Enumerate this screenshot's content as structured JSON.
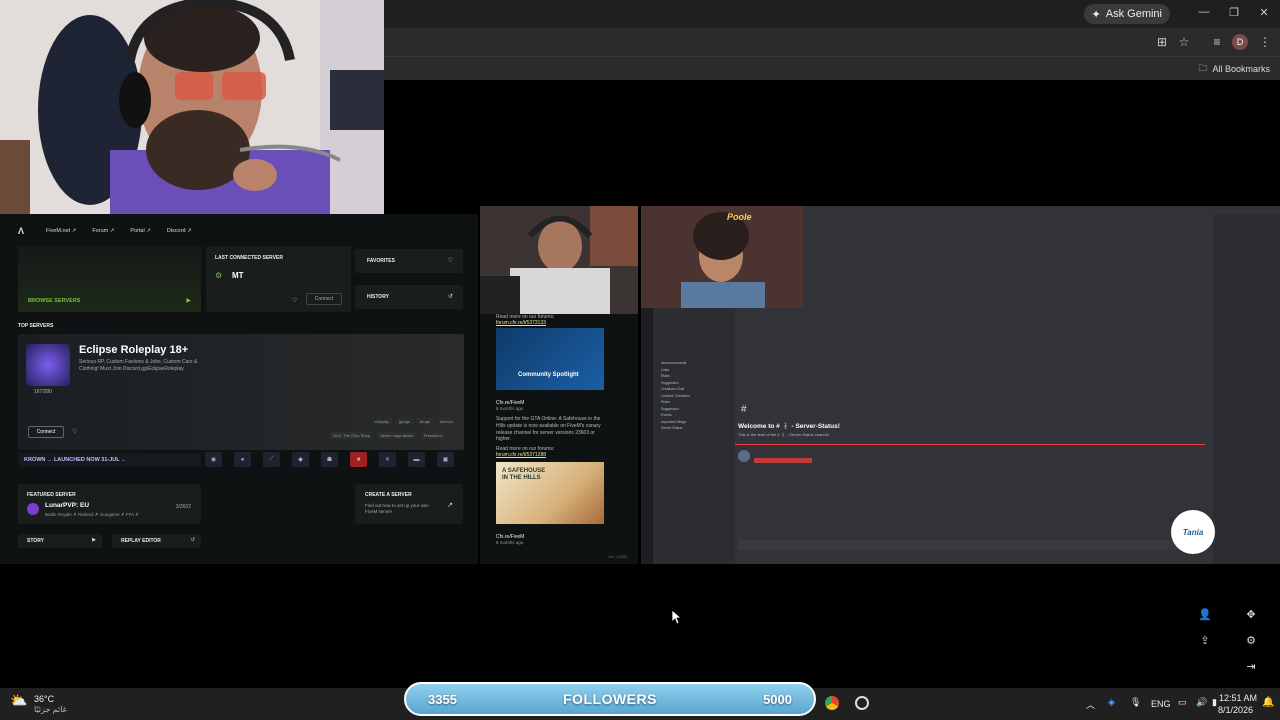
{
  "browser": {
    "ask_gemini": "Ask Gemini",
    "profile_initial": "D",
    "bookmarks_label": "All Bookmarks"
  },
  "fivem": {
    "nav": [
      "FiveM.net ↗",
      "Forum ↗",
      "Portal ↗",
      "Discord ↗"
    ],
    "browse_servers": "BROWSE SERVERS",
    "last_connected_label": "LAST CONNECTED SERVER",
    "last_server_name": "MT",
    "connect_small": "Connect",
    "favorites": "FAVORITES",
    "history": "HISTORY",
    "top_servers": "TOP SERVERS",
    "eclipse_title": "Eclipse Roleplay 18+",
    "eclipse_desc": "Serious RP, Custom Factions & Jobs, Custom Cars & Clothing! Must Join Discord.gg/EclipseRoleplay",
    "eclipse_players": "167/200",
    "eclipse_connect": "Connect",
    "tags": [
      "roleplay",
      "gangs",
      "drugs",
      "serious"
    ],
    "badges": [
      "SLO: The Ohio Shop",
      "Seven rings sticker",
      "Freemium"
    ],
    "krown": "KROWN → LAUNCHED NOW 31-JUL ←",
    "featured_label": "FEATURED SERVER",
    "featured_name": "LunarPVP: EU",
    "featured_desc": "Battle Royale ✗ Ranked ✗ Gungame ✗ FFA ✗",
    "featured_players": "3/2602",
    "create_server": "CREATE A SERVER",
    "create_desc": "Find out how to set up your own FiveM server!",
    "story": "STORY",
    "replay_editor": "REPLAY EDITOR",
    "version": "Ver. 13206"
  },
  "news": {
    "read_more_1": "Read more on our forums:",
    "link_1": "forum.cfx.re/t/5373133",
    "spotlight_label": "Community Spotlight",
    "item_source": "Cfx.re/FiveM",
    "item_age": "8 months ago",
    "item_text": "Support for the GTA Online: A Safehouse in the Hills update is now available on FiveM's canary release channel for server versions 23603 or higher.",
    "link_2": "forum.cfx.re/t/5371288",
    "safehouse": "A SAFEHOUSE IN THE HILLS",
    "item_source_2": "Cfx.re/FiveM",
    "item_age_2": "8 months ago"
  },
  "discord": {
    "welcome": "Welcome to # 🚦 - Server-Status!",
    "welcome_sub": "This is the start of the # 🚦 - Server-Status channel.",
    "hash": "#",
    "cam_sign": "Poole",
    "channels": [
      "Announcements",
      "Links",
      "Rules",
      "Suggestion",
      "Creations Chat",
      "Contest: Creations",
      "Rules",
      "Suggestion",
      "Events",
      "Important things",
      "Server Status"
    ]
  },
  "stream": {
    "followers_current": "3355",
    "followers_label": "FOLLOWERS",
    "followers_goal": "5000",
    "badge_text": "Tania"
  },
  "taskbar": {
    "temp": "36°C",
    "weather": "غائم جزئيًا",
    "lang": "ENG",
    "time": "12:51 AM",
    "date": "8/1/2026"
  },
  "colors": {
    "fivem_green": "#7ac143",
    "follower_bar": "#6bb6dc",
    "discord_bg": "#313338"
  }
}
